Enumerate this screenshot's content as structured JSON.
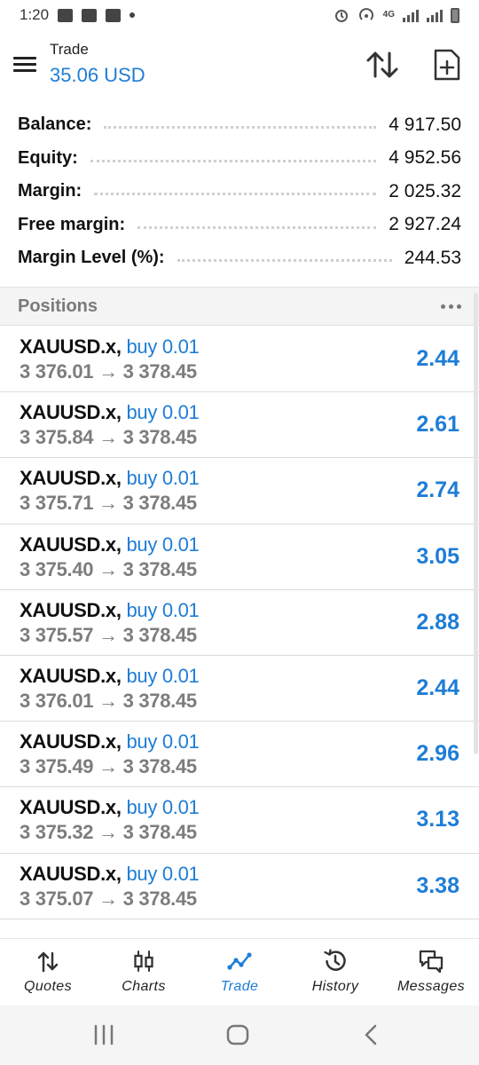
{
  "status_bar": {
    "time": "1:20",
    "network": "4G"
  },
  "header": {
    "title": "Trade",
    "value": "35.06 USD"
  },
  "account": [
    {
      "label": "Balance:",
      "value": "4 917.50"
    },
    {
      "label": "Equity:",
      "value": "4 952.56"
    },
    {
      "label": "Margin:",
      "value": "2 025.32"
    },
    {
      "label": "Free margin:",
      "value": "2 927.24"
    },
    {
      "label": "Margin Level (%):",
      "value": "244.53"
    }
  ],
  "positions": {
    "title": "Positions",
    "items": [
      {
        "symbol": "XAUUSD.x,",
        "type": "buy 0.01",
        "open": "3 376.01",
        "arrow": "→",
        "current": "3 378.45",
        "profit": "2.44"
      },
      {
        "symbol": "XAUUSD.x,",
        "type": "buy 0.01",
        "open": "3 375.84",
        "arrow": "→",
        "current": "3 378.45",
        "profit": "2.61"
      },
      {
        "symbol": "XAUUSD.x,",
        "type": "buy 0.01",
        "open": "3 375.71",
        "arrow": "→",
        "current": "3 378.45",
        "profit": "2.74"
      },
      {
        "symbol": "XAUUSD.x,",
        "type": "buy 0.01",
        "open": "3 375.40",
        "arrow": "→",
        "current": "3 378.45",
        "profit": "3.05"
      },
      {
        "symbol": "XAUUSD.x,",
        "type": "buy 0.01",
        "open": "3 375.57",
        "arrow": "→",
        "current": "3 378.45",
        "profit": "2.88"
      },
      {
        "symbol": "XAUUSD.x,",
        "type": "buy 0.01",
        "open": "3 376.01",
        "arrow": "→",
        "current": "3 378.45",
        "profit": "2.44"
      },
      {
        "symbol": "XAUUSD.x,",
        "type": "buy 0.01",
        "open": "3 375.49",
        "arrow": "→",
        "current": "3 378.45",
        "profit": "2.96"
      },
      {
        "symbol": "XAUUSD.x,",
        "type": "buy 0.01",
        "open": "3 375.32",
        "arrow": "→",
        "current": "3 378.45",
        "profit": "3.13"
      },
      {
        "symbol": "XAUUSD.x,",
        "type": "buy 0.01",
        "open": "3 375.07",
        "arrow": "→",
        "current": "3 378.45",
        "profit": "3.38"
      }
    ]
  },
  "nav": [
    {
      "label": "Quotes",
      "icon": "quotes-icon"
    },
    {
      "label": "Charts",
      "icon": "charts-icon"
    },
    {
      "label": "Trade",
      "icon": "trade-icon",
      "active": true
    },
    {
      "label": "History",
      "icon": "history-icon"
    },
    {
      "label": "Messages",
      "icon": "messages-icon"
    }
  ],
  "colors": {
    "accent": "#1e7dd6",
    "muted": "#7d7d7d",
    "text": "#111111"
  }
}
